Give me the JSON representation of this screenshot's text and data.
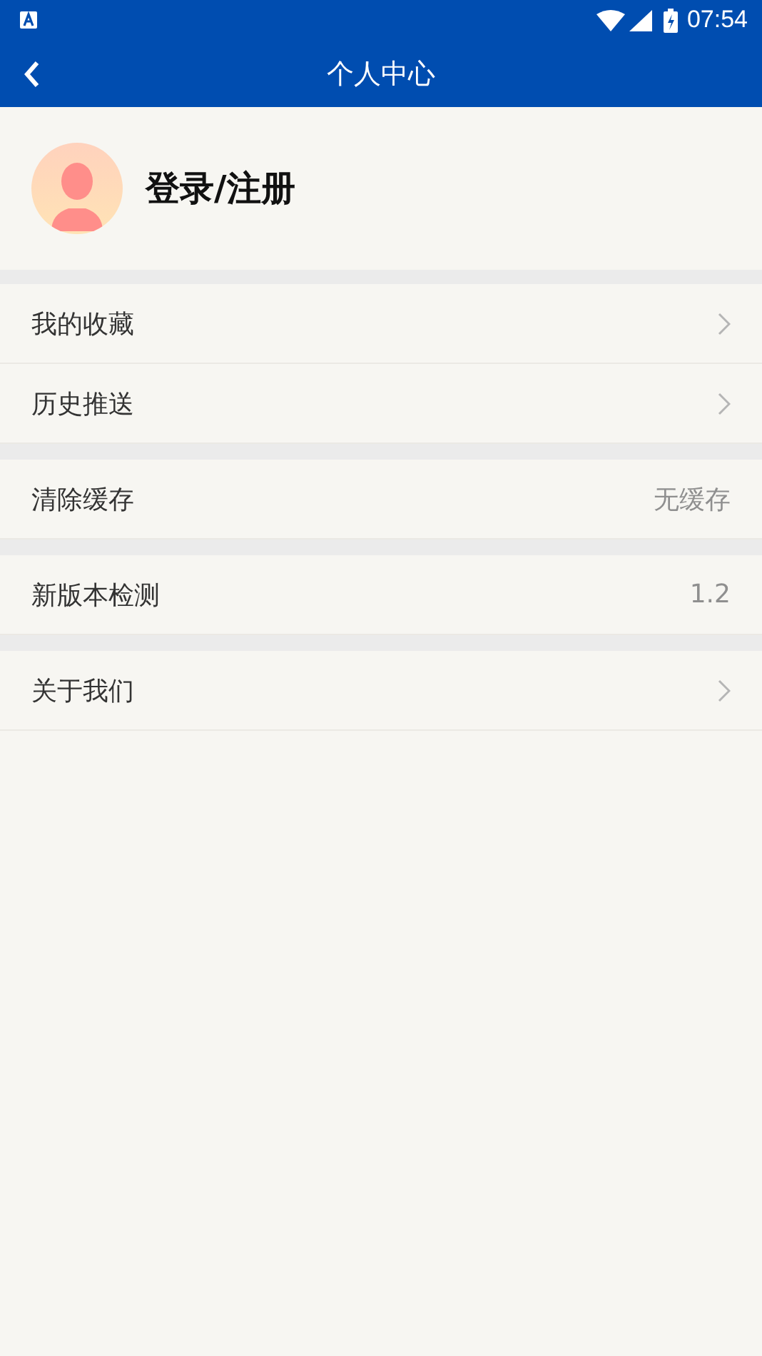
{
  "status_bar": {
    "time": "07:54"
  },
  "app_bar": {
    "title": "个人中心"
  },
  "profile": {
    "label": "登录/注册"
  },
  "sections": [
    {
      "items": [
        {
          "kind": "link",
          "label": "我的收藏"
        },
        {
          "kind": "link",
          "label": "历史推送"
        }
      ]
    },
    {
      "items": [
        {
          "kind": "value",
          "label": "清除缓存",
          "value": "无缓存"
        }
      ]
    },
    {
      "items": [
        {
          "kind": "value",
          "label": "新版本检测",
          "value": "1.2"
        }
      ]
    },
    {
      "items": [
        {
          "kind": "link",
          "label": "关于我们"
        }
      ]
    }
  ]
}
